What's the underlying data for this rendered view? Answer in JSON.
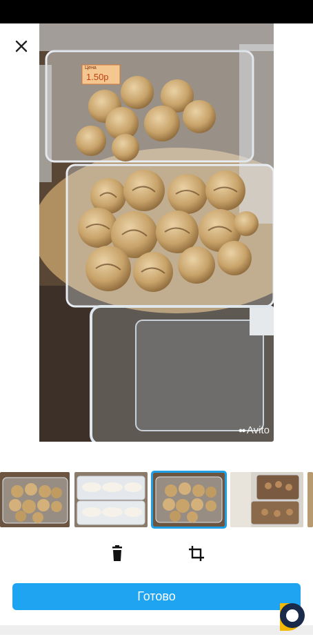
{
  "viewer": {
    "close_icon": "close-icon",
    "price_tag": "1.50р",
    "price_tag_header": "Цена",
    "watermark": "Avito"
  },
  "thumbnails": [
    {
      "name": "thumb-cookies-nuts",
      "selected": false
    },
    {
      "name": "thumb-meringue",
      "selected": false
    },
    {
      "name": "thumb-cookies-nuts-2",
      "selected": true
    },
    {
      "name": "thumb-pastries",
      "selected": false
    },
    {
      "name": "thumb-partial",
      "selected": false
    }
  ],
  "toolbar": {
    "delete_icon": "trash-icon",
    "crop_icon": "crop-icon"
  },
  "actions": {
    "done_label": "Готово"
  },
  "colors": {
    "accent": "#1ea4f0",
    "selection": "#1e9fea"
  }
}
